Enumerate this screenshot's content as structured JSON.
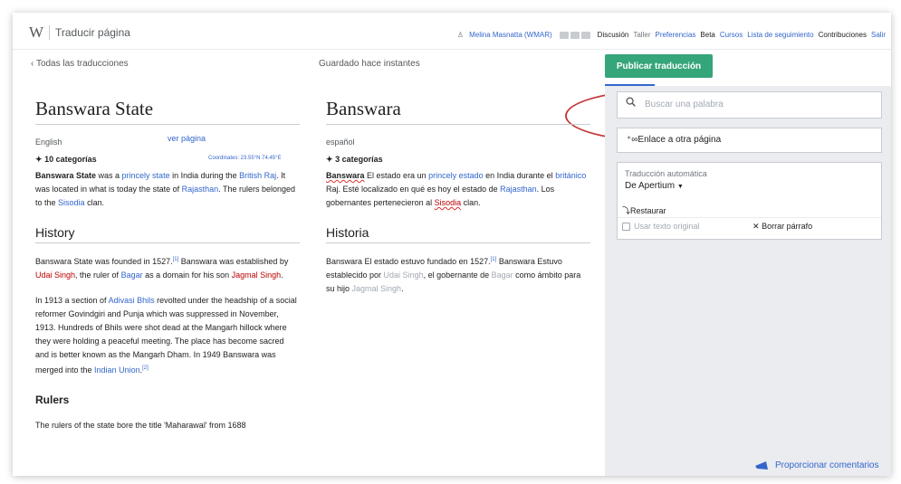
{
  "header": {
    "logo": "W",
    "app_title": "Traducir página",
    "user": "Melina Masnatta (WMAR)",
    "links": [
      "Discusión",
      "Taller",
      "Preferencias",
      "Beta",
      "Cursos",
      "Lista de seguimiento",
      "Contribuciones",
      "Salir"
    ]
  },
  "toolbar": {
    "back": "Todas las traducciones",
    "saved": "Guardado hace instantes",
    "publish": "Publicar traducción"
  },
  "source": {
    "title": "Banswara State",
    "language": "English",
    "view_page": "ver página",
    "categories": "10 categorías",
    "coordinates": "Coordinates: 23.55°N 74.45°E",
    "intro": [
      "Banswara State",
      " was a ",
      "princely state",
      " in India during the ",
      "British Raj",
      ". It was located in what is today the state of ",
      "Rajasthan",
      ". The rulers belonged to the ",
      "Sisodia",
      " clan."
    ],
    "history_heading": "History",
    "history_p1": [
      "Banswara State was founded in 1527.",
      "[1]",
      " Banswara was established by ",
      "Udai Singh",
      ", the ruler of ",
      "Bagar",
      " as a domain for his son ",
      "Jagmal Singh",
      "."
    ],
    "history_p2": [
      "In 1913 a section of ",
      "Adivasi Bhils",
      " revolted under the headship of a social reformer Govindgiri and Punja which was suppressed in November, 1913. Hundreds of Bhils were shot dead at the Mangarh hillock where they were holding a peaceful meeting. The place has become sacred and is better known as the Mangarh Dham. In 1949 Banswara was merged into the ",
      "Indian Union",
      ".",
      "[2]"
    ],
    "rulers_heading": "Rulers",
    "rulers_text": "The rulers of the state bore the title 'Maharawal' from 1688"
  },
  "target": {
    "title": "Banswara",
    "language": "español",
    "categories": "3 categorías",
    "intro": [
      "Banswara",
      " El estado era un ",
      "princely estado",
      " en India durante el ",
      "británico",
      " Raj. Esté localizado en qué es hoy el estado de ",
      "Rajasthan",
      ". Los gobernantes pertenecieron al ",
      "Sisodia",
      " clan."
    ],
    "history_heading": "Historia",
    "history_p1": [
      "Banswara El estado estuvo fundado en 1527.",
      "[1]",
      " Banswara Estuvo establecido por ",
      "Udai Singh",
      ", el gobernante de ",
      "Bagar",
      " como ámbito para su hijo ",
      "Jagmal Singh",
      "."
    ]
  },
  "tools": {
    "search_placeholder": "Buscar una palabra",
    "link_label": "Enlace a otra página",
    "mt_caption": "Traducción automática",
    "mt_provider": "De Apertium",
    "restore": "Restaurar",
    "use_original": "Usar texto original",
    "clear_paragraph": "Borrar párrafo"
  },
  "footer": {
    "feedback": "Proporcionar comentarios"
  },
  "colors": {
    "link": "#3366cc",
    "publish_bg": "#35a57a",
    "annotation": "#c63a3a",
    "redlink": "#ba0000"
  }
}
